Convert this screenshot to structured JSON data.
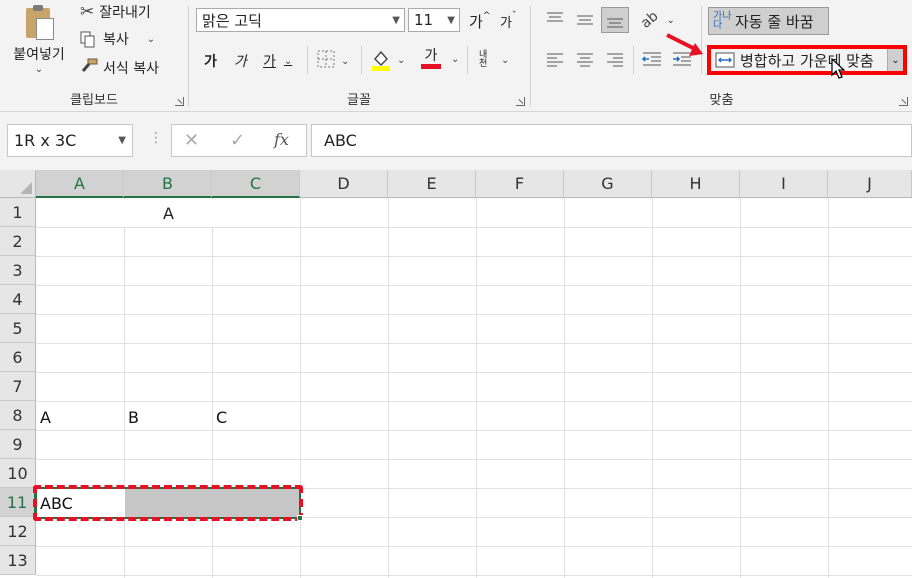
{
  "ribbon": {
    "clipboard": {
      "paste_label": "붙여넣기",
      "cut_label": "잘라내기",
      "copy_label": "복사",
      "format_painter_label": "서식 복사",
      "group_label": "클립보드"
    },
    "font": {
      "font_name": "맑은 고딕",
      "font_size": "11",
      "increase_size_glyph": "가",
      "decrease_size_glyph": "가",
      "bold_glyph": "가",
      "italic_glyph": "가",
      "underline_glyph": "가",
      "font_color_glyph": "가",
      "phonetic_glyph": "내천",
      "group_label": "글꼴",
      "fill_color": "#ffff00",
      "font_color": "#e81123"
    },
    "alignment": {
      "wrap_text_label": "자동 줄 바꿈",
      "merge_center_label": "병합하고 가운데 맞춤",
      "group_label": "맞춤",
      "highlight_color": "#ff0000"
    }
  },
  "formula_bar": {
    "name_box": "1R x 3C",
    "cancel_glyph": "✕",
    "enter_glyph": "✓",
    "fx_glyph": "fx",
    "content": "ABC"
  },
  "grid": {
    "columns": [
      "A",
      "B",
      "C",
      "D",
      "E",
      "F",
      "G",
      "H",
      "I",
      "J"
    ],
    "rows": [
      "1",
      "2",
      "3",
      "4",
      "5",
      "6",
      "7",
      "8",
      "9",
      "10",
      "11",
      "12",
      "13"
    ],
    "cells": {
      "r1_merged": "A",
      "r8_a": "A",
      "r8_b": "B",
      "r8_c": "C",
      "r11_a": "ABC"
    },
    "selection_color": "#217346",
    "marquee_color": "#e81123"
  }
}
